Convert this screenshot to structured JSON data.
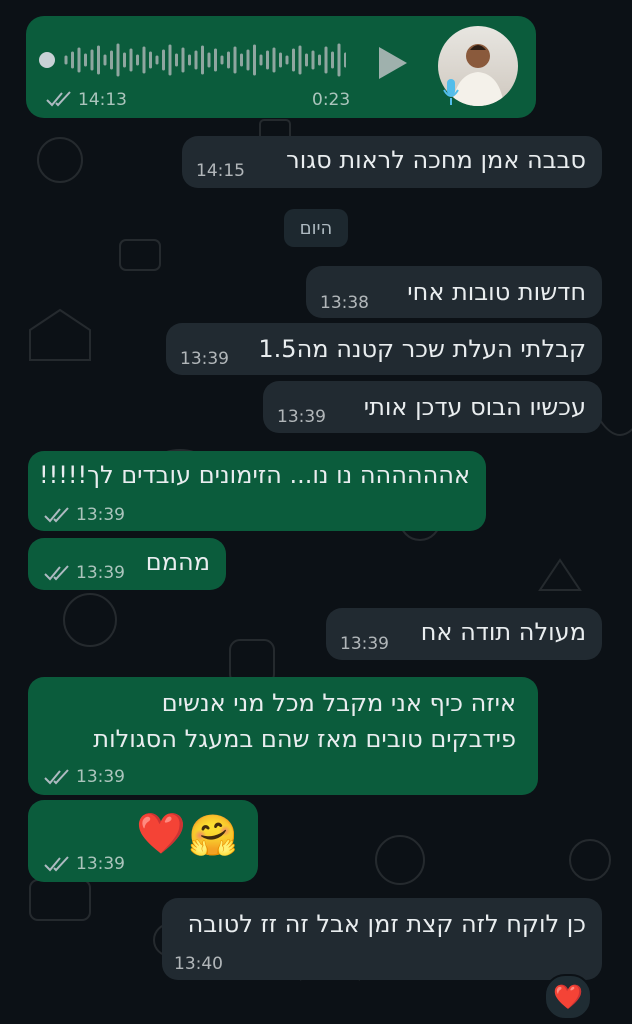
{
  "voice_message": {
    "sent_time": "14:13",
    "duration": "0:23",
    "status": "read",
    "play_icon": "play-icon",
    "mic_icon": "mic-icon"
  },
  "messages": [
    {
      "direction": "incoming",
      "text": "סבבה אמן מחכה לראות סגור",
      "time": "14:15"
    },
    {
      "direction": "incoming",
      "text": "חדשות טובות אחי",
      "time": "13:38"
    },
    {
      "direction": "incoming",
      "text": "קבלתי העלת שכר קטנה מה1.5",
      "time": "13:39"
    },
    {
      "direction": "incoming",
      "text": "עכשיו הבוס עדכן אותי",
      "time": "13:39"
    },
    {
      "direction": "outgoing",
      "text": "אהההההה נו נו... הזימונים עובדים לך!!!!!",
      "time": "13:39",
      "status": "read"
    },
    {
      "direction": "outgoing",
      "text": "מהמם",
      "time": "13:39",
      "status": "read"
    },
    {
      "direction": "incoming",
      "text": "מעולה תודה אח",
      "time": "13:39"
    },
    {
      "direction": "outgoing",
      "line1": "איזה כיף אני מקבל מכל מני אנשים",
      "line2": "פידבקים טובים מאז שהם במעגל הסגולות",
      "time": "13:39",
      "status": "read"
    },
    {
      "direction": "outgoing",
      "emoji1": "🤗",
      "emoji2": "❤️",
      "time": "13:39",
      "status": "read"
    },
    {
      "direction": "incoming",
      "text": "כן לוקח לזה קצת זמן אבל זה זז לטובה",
      "time": "13:40",
      "reaction": "❤️"
    }
  ],
  "date_divider": "היום",
  "colors": {
    "background": "#0c1116",
    "outgoing_bubble": "#0b5c3c",
    "incoming_bubble": "#212a31",
    "read_ticks": "#aebac1"
  }
}
